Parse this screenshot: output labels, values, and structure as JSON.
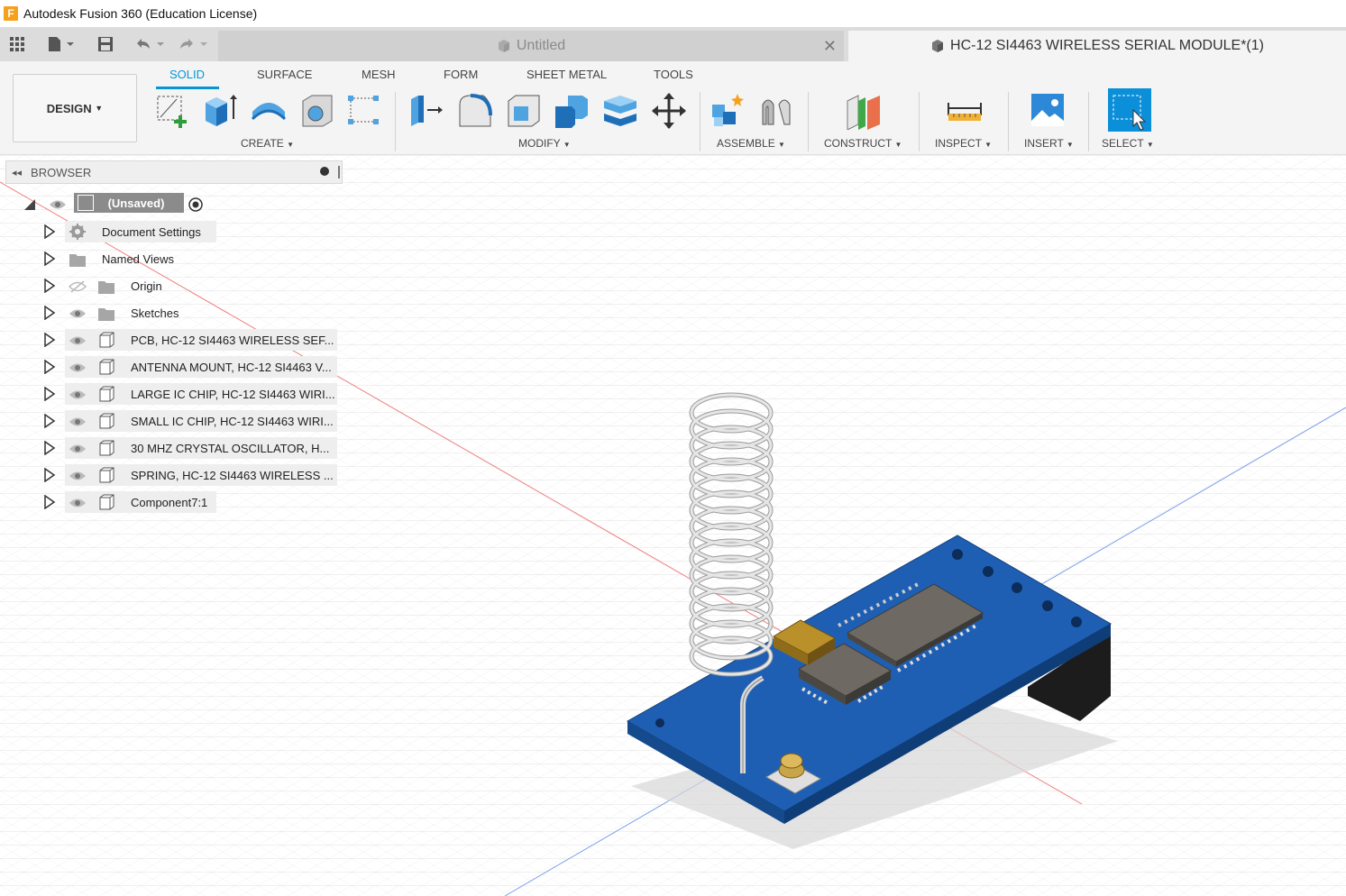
{
  "app": {
    "title": "Autodesk Fusion 360 (Education License)",
    "logo_letter": "F"
  },
  "tabs": [
    {
      "label": "Untitled",
      "active": false
    },
    {
      "label": "HC-12 SI4463 WIRELESS SERIAL MODULE*(1)",
      "active": true
    }
  ],
  "toolbar": {
    "workspace_label": "DESIGN",
    "workspace_tabs": [
      "SOLID",
      "SURFACE",
      "MESH",
      "FORM",
      "SHEET METAL",
      "TOOLS"
    ],
    "groups": [
      "CREATE",
      "MODIFY",
      "ASSEMBLE",
      "CONSTRUCT",
      "INSPECT",
      "INSERT",
      "SELECT"
    ]
  },
  "browser": {
    "title": "BROWSER",
    "root_label": "(Unsaved)",
    "items": [
      {
        "label": "Document Settings",
        "icon": "gear-icon"
      },
      {
        "label": "Named Views",
        "icon": "folder-icon"
      },
      {
        "label": "Origin",
        "icon": "folder-icon"
      },
      {
        "label": "Sketches",
        "icon": "folder-icon"
      },
      {
        "label": "PCB, HC-12 SI4463 WIRELESS SEF...",
        "icon": "component-icon"
      },
      {
        "label": "ANTENNA MOUNT, HC-12 SI4463 V...",
        "icon": "component-icon"
      },
      {
        "label": "LARGE IC CHIP, HC-12 SI4463 WIRI...",
        "icon": "component-icon"
      },
      {
        "label": "SMALL IC CHIP, HC-12 SI4463 WIRI...",
        "icon": "component-icon"
      },
      {
        "label": "30 MHZ CRYSTAL OSCILLATOR, H...",
        "icon": "component-icon"
      },
      {
        "label": "SPRING, HC-12 SI4463 WIRELESS ...",
        "icon": "component-icon"
      },
      {
        "label": "Component7:1",
        "icon": "component-icon"
      }
    ]
  },
  "colors": {
    "accent": "#0696d7",
    "pcb": "#1f5fb3",
    "toolbar_bg": "#f4f4f4"
  }
}
